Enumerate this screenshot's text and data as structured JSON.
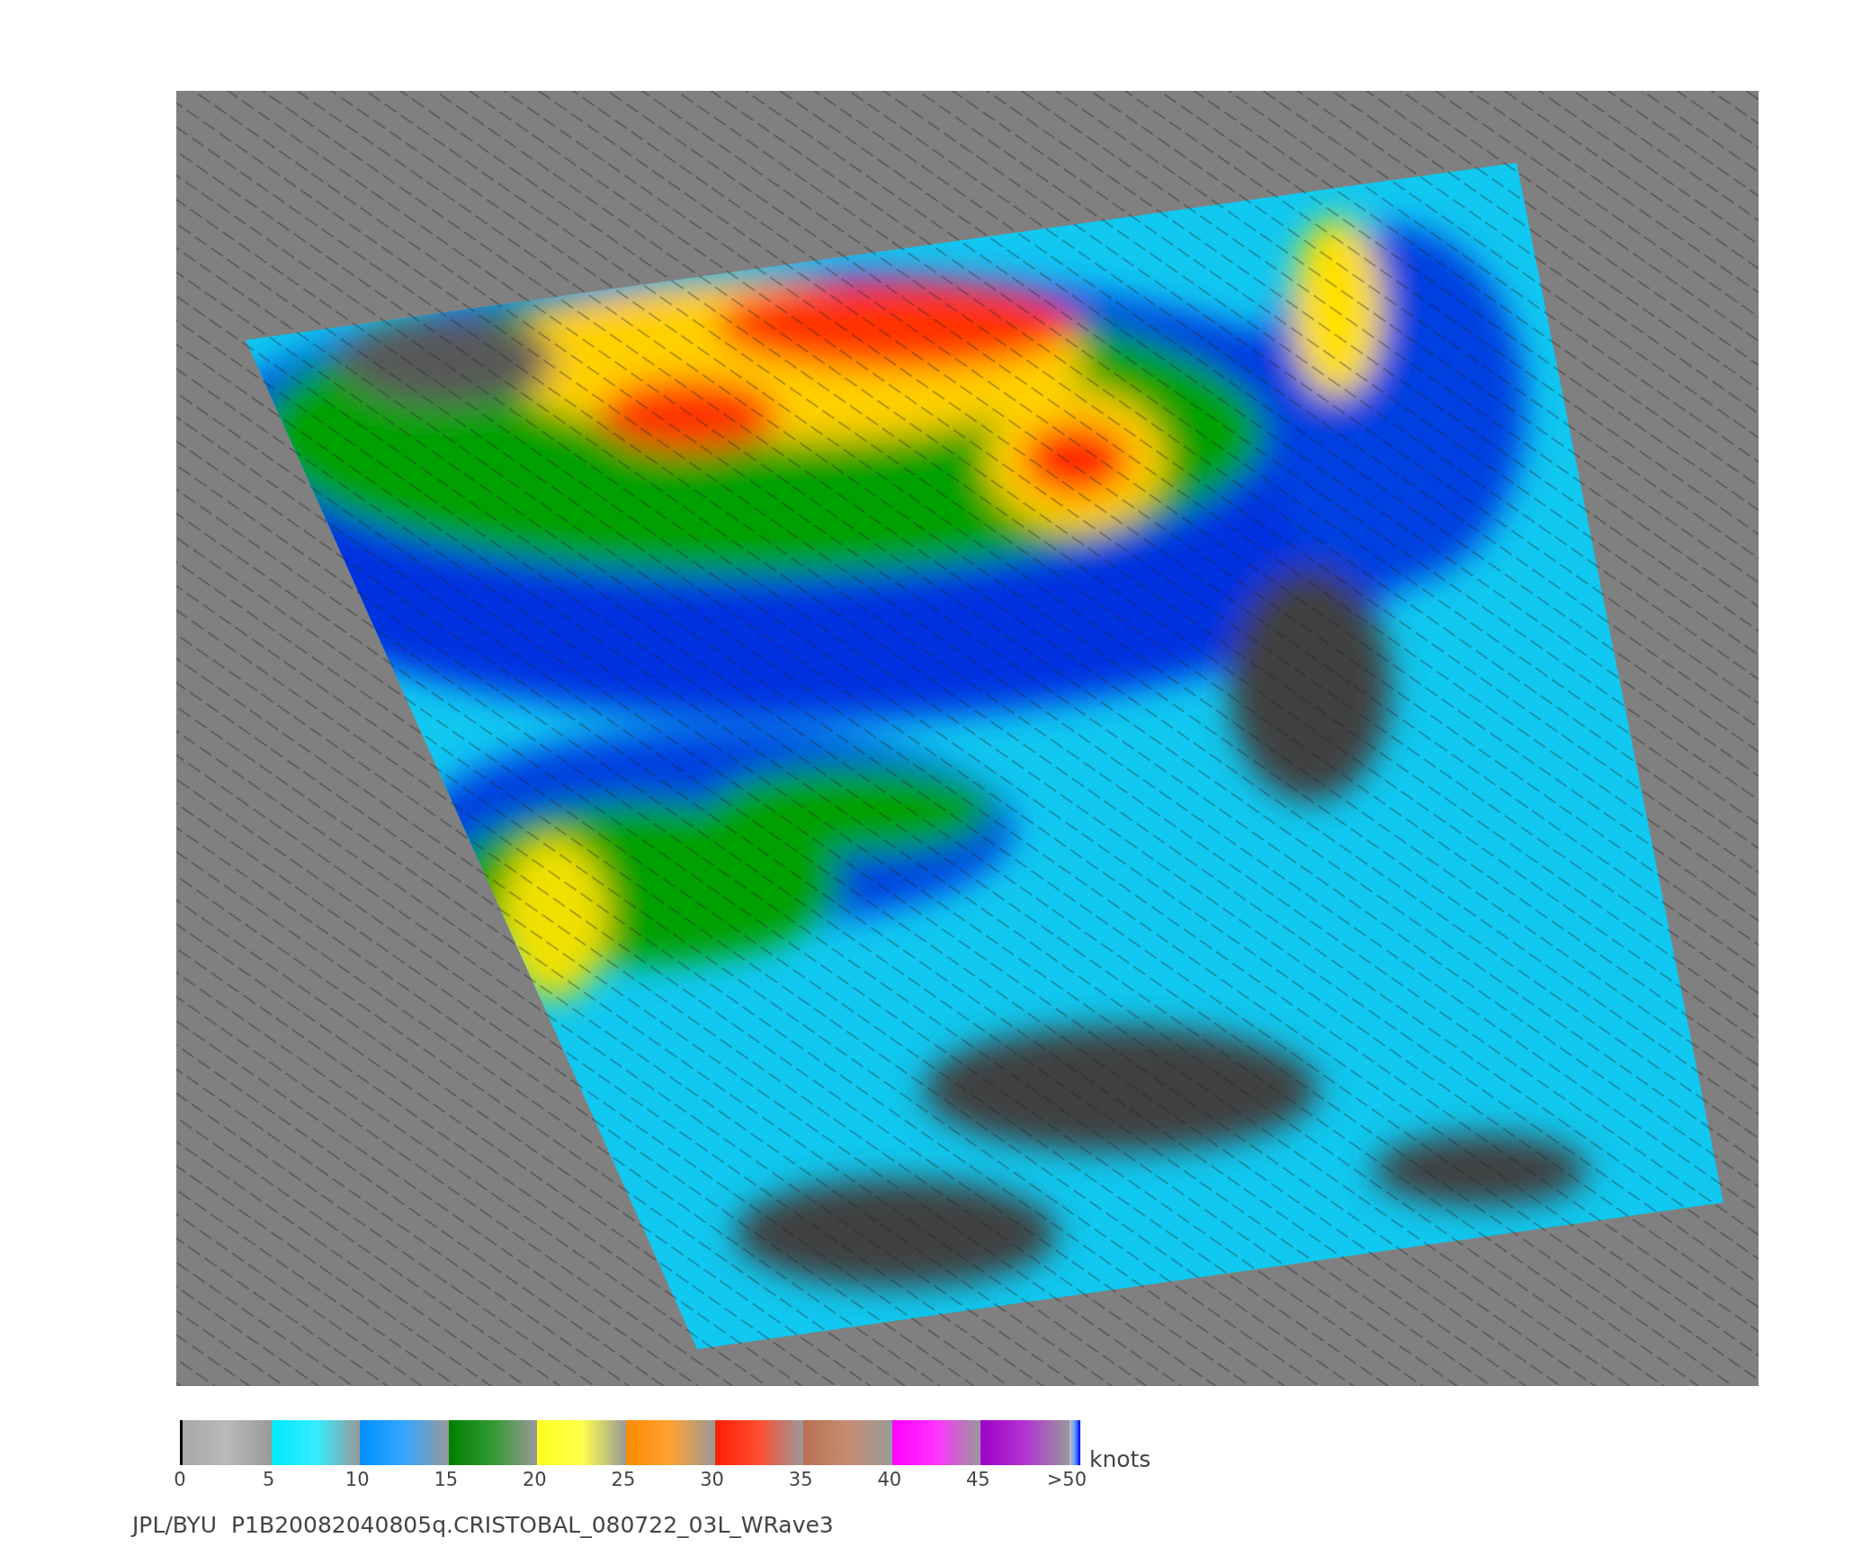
{
  "colorbar": {
    "segments": [
      {
        "color": "#a8a8a8"
      },
      {
        "color": "#00e8ff"
      },
      {
        "color": "#0090ff"
      },
      {
        "color": "#008000"
      },
      {
        "color": "#ffff20"
      },
      {
        "color": "#ff8a00"
      },
      {
        "color": "#ff2000"
      },
      {
        "color": "#b87050"
      },
      {
        "color": "#ff00ff"
      },
      {
        "color": "#a000c8"
      }
    ],
    "tick_labels": [
      "0",
      "5",
      "10",
      "15",
      "20",
      "25",
      "30",
      "35",
      "40",
      "45",
      ">50"
    ],
    "unit": "knots"
  },
  "caption": "JPL/BYU  P1B20082040805q.CRISTOBAL_080722_03L_WRave3"
}
